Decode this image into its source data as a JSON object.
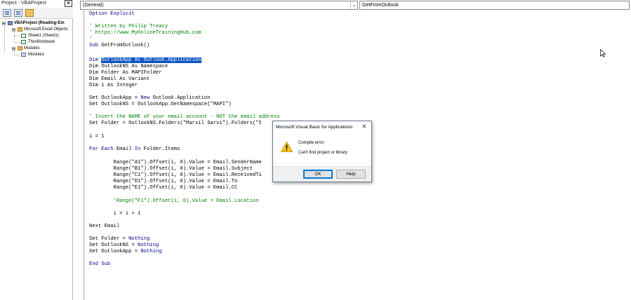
{
  "project_explorer": {
    "title": "Project - VBAProject",
    "close_glyph": "✕",
    "toolbar": [
      "view-code-icon",
      "view-object-icon",
      "toggle-folders-icon"
    ],
    "tree": {
      "project": "VBAProject (Reading-Em",
      "excel_objects_folder": "Microsoft Excel Objects",
      "sheet1": "Sheet1 (Sheet1)",
      "thisworkbook": "ThisWorkbook",
      "modules_folder": "Modules",
      "module1": "Module1"
    }
  },
  "code_window": {
    "object_combo": "(General)",
    "procedure_combo": "GetFromOutlook",
    "combo_arrow": "⌄",
    "lines": {
      "l0": "Option Explicit",
      "l2": "' Written by Philip Treacy",
      "l3": "' https://www.MyOnlineTrainingHub.com",
      "l4": "'",
      "l5a": "Sub",
      "l5b": " GetFromOutlook()",
      "l7a": "Dim ",
      "l7b": "OutlookApp As Outlook.Application",
      "l8": "Dim OutlookNS As Namespace",
      "l9": "Dim Folder As MAPIFolder",
      "l10": "Dim Email As Variant",
      "l11": "Dim i As Integer",
      "l13a": "Set OutlookApp = ",
      "l13b": "New",
      "l13c": " Outlook.Application",
      "l14": "Set OutlookNS = OutlookApp.GetNamespace(\"MAPI\")",
      "l16": "' Insert the NAME of your email account - NOT the email address",
      "l17": "Set Folder = OutlookNS.Folders(\"Marsil Sarvi\").Folders(\"I",
      "l19": "i = 1",
      "l21a": "For Each",
      "l21b": " Email ",
      "l21c": "In",
      "l21d": " Folder.Items",
      "l23": "        Range(\"A1\").Offset(i, 0).Value = Email.SenderName",
      "l24": "        Range(\"B1\").Offset(i, 0).Value = Email.Subject",
      "l25": "        Range(\"C1\").Offset(i, 0).Value = Email.ReceivedTi",
      "l26": "        Range(\"D1\").Offset(i, 0).Value = Email.To",
      "l27": "        Range(\"E1\").Offset(i, 0).Value = Email.CC",
      "l29": "        'Range(\"F1\").Offset(i, 0).Value = Email.Location",
      "l31": "        i = i + 1",
      "l33": "Next Email",
      "l35a": "Set Folder = ",
      "l35b": "Nothing",
      "l36a": "Set OutlookNS = ",
      "l36b": "Nothing",
      "l37a": "Set OutlookApp = ",
      "l37b": "Nothing",
      "l39": "End Sub"
    }
  },
  "dialog": {
    "title": "Microsoft Visual Basic for Applications",
    "close_glyph": "✕",
    "icon": "warning-icon",
    "heading": "Compile error:",
    "message": "Can't find project or library",
    "ok_label": "OK",
    "help_label": "Help"
  },
  "colors": {
    "comment": "#008000",
    "keyword": "#00008b",
    "selection": "#0a53c1",
    "warning": "#f5c518"
  }
}
